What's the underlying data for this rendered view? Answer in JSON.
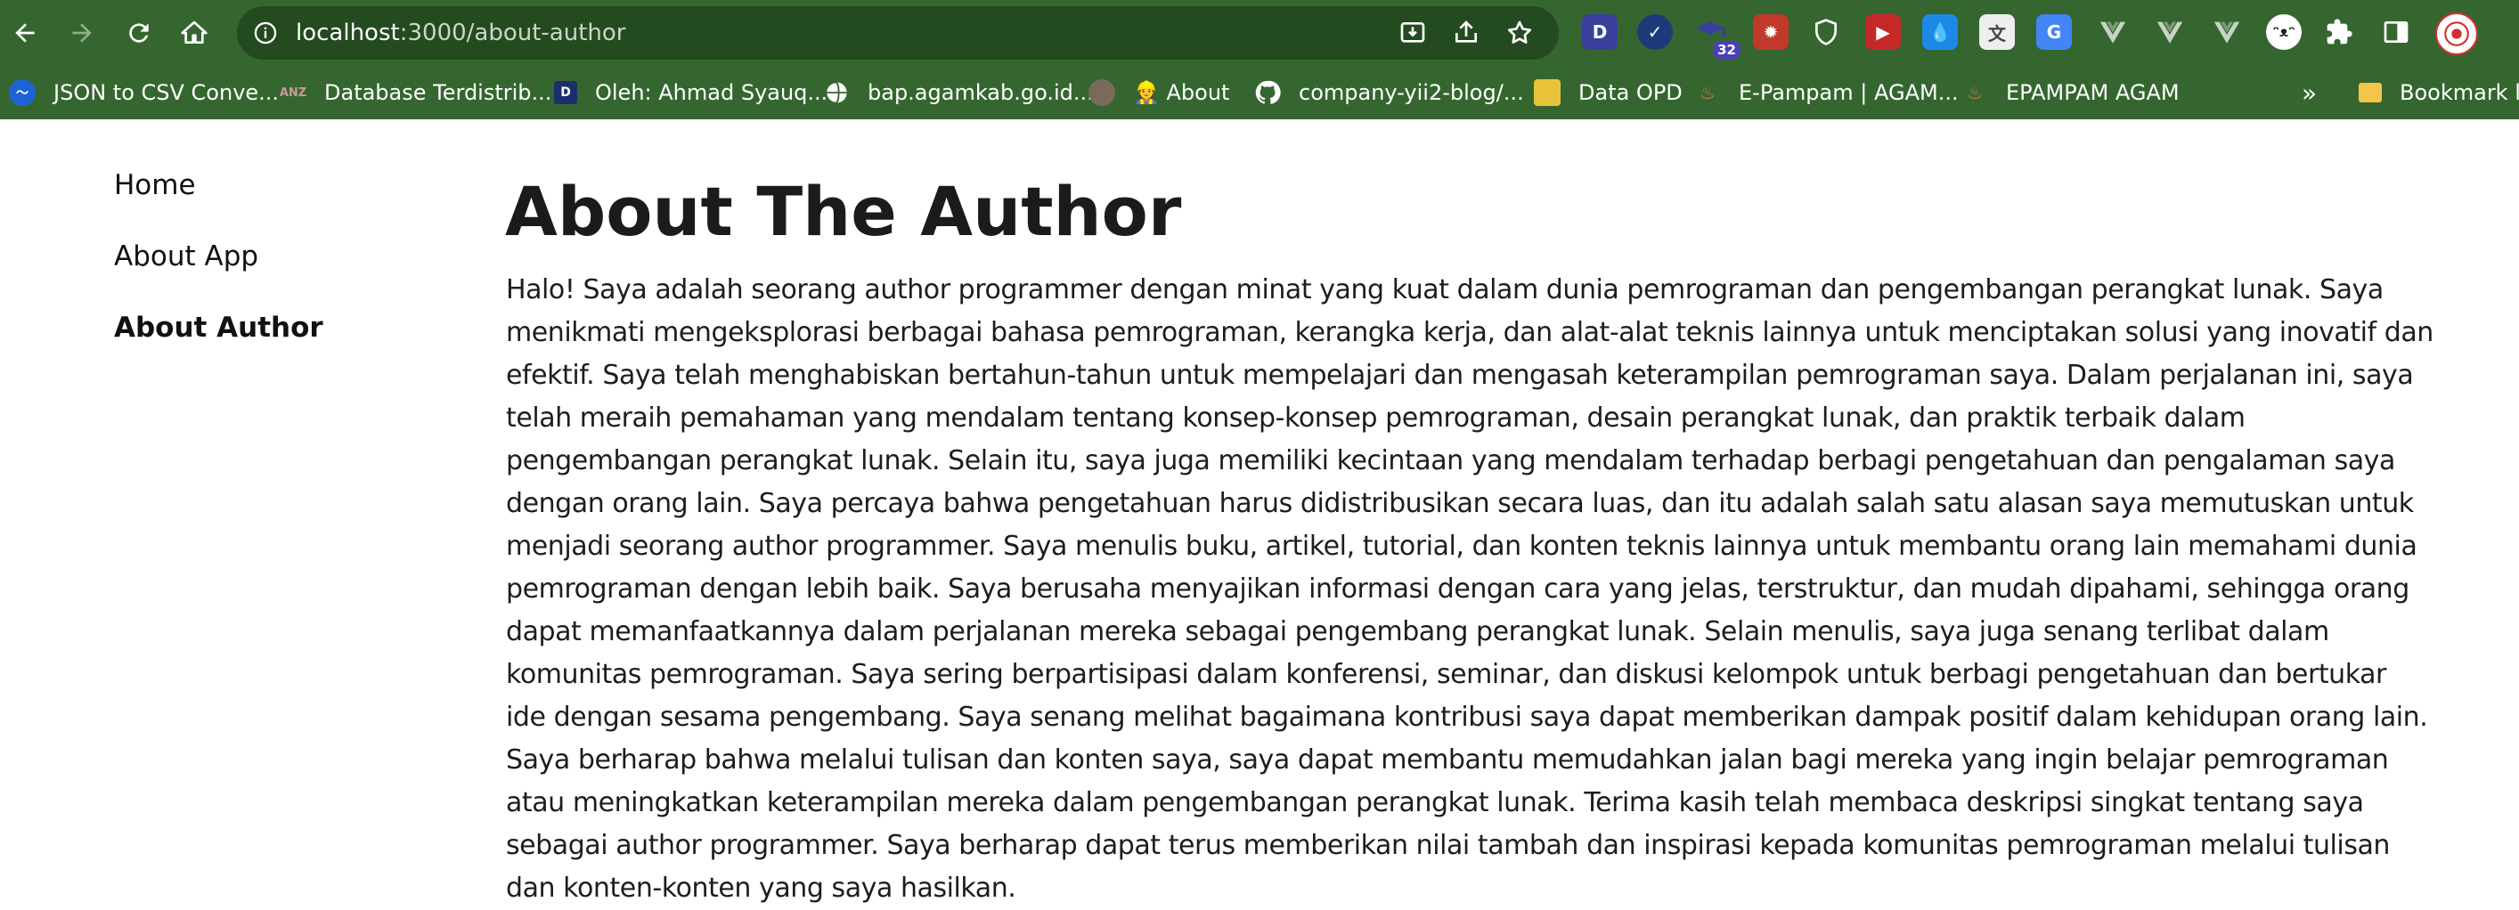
{
  "browser": {
    "url_host": "localhost",
    "url_path": ":3000/about-author",
    "extension_badge": "32",
    "bookmarks": [
      {
        "label": "JSON to CSV Conve...",
        "icon": "wave-icon"
      },
      {
        "label": "Database Terdistrib...",
        "icon": "anz-icon"
      },
      {
        "label": "Oleh: Ahmad Syauq...",
        "icon": "d-square-icon"
      },
      {
        "label": "bap.agamkab.go.id...",
        "icon": "globe-icon"
      },
      {
        "label": "👷 About",
        "icon": "avatar-icon"
      },
      {
        "label": "company-yii2-blog/...",
        "icon": "github-icon"
      },
      {
        "label": "Data OPD",
        "icon": "emblem-icon"
      },
      {
        "label": "E-Pampam | AGAM...",
        "icon": "flame-icon"
      },
      {
        "label": "EPAMPAM AGAM",
        "icon": "flame-icon"
      }
    ],
    "bookmarks_overflow": "»",
    "bookmarks_folder": "Bookmark lai"
  },
  "sidebar": {
    "items": [
      {
        "label": "Home",
        "active": false
      },
      {
        "label": "About App",
        "active": false
      },
      {
        "label": "About Author",
        "active": true
      }
    ]
  },
  "main": {
    "title": "About The Author",
    "body": "Halo! Saya adalah seorang author programmer dengan minat yang kuat dalam dunia pemrograman dan pengembangan perangkat lunak. Saya menikmati mengeksplorasi berbagai bahasa pemrograman, kerangka kerja, dan alat-alat teknis lainnya untuk menciptakan solusi yang inovatif dan efektif. Saya telah menghabiskan bertahun-tahun untuk mempelajari dan mengasah keterampilan pemrograman saya. Dalam perjalanan ini, saya telah meraih pemahaman yang mendalam tentang konsep-konsep pemrograman, desain perangkat lunak, dan praktik terbaik dalam pengembangan perangkat lunak. Selain itu, saya juga memiliki kecintaan yang mendalam terhadap berbagi pengetahuan dan pengalaman saya dengan orang lain. Saya percaya bahwa pengetahuan harus didistribusikan secara luas, dan itu adalah salah satu alasan saya memutuskan untuk menjadi seorang author programmer. Saya menulis buku, artikel, tutorial, dan konten teknis lainnya untuk membantu orang lain memahami dunia pemrograman dengan lebih baik. Saya berusaha menyajikan informasi dengan cara yang jelas, terstruktur, dan mudah dipahami, sehingga orang dapat memanfaatkannya dalam perjalanan mereka sebagai pengembang perangkat lunak. Selain menulis, saya juga senang terlibat dalam komunitas pemrograman. Saya sering berpartisipasi dalam konferensi, seminar, dan diskusi kelompok untuk berbagi pengetahuan dan bertukar ide dengan sesama pengembang. Saya senang melihat bagaimana kontribusi saya dapat memberikan dampak positif dalam kehidupan orang lain. Saya berharap bahwa melalui tulisan dan konten saya, saya dapat membantu memudahkan jalan bagi mereka yang ingin belajar pemrograman atau meningkatkan keterampilan mereka dalam pengembangan perangkat lunak. Terima kasih telah membaca deskripsi singkat tentang saya sebagai author programmer. Saya berharap dapat terus memberikan nilai tambah dan inspirasi kepada komunitas pemrograman melalui tulisan dan konten-konten yang saya hasilkan."
  },
  "colors": {
    "chrome_toolbar": "#35662f",
    "omnibox": "#244a20",
    "page_background": "#ffffff",
    "text": "#1d1d1d"
  }
}
